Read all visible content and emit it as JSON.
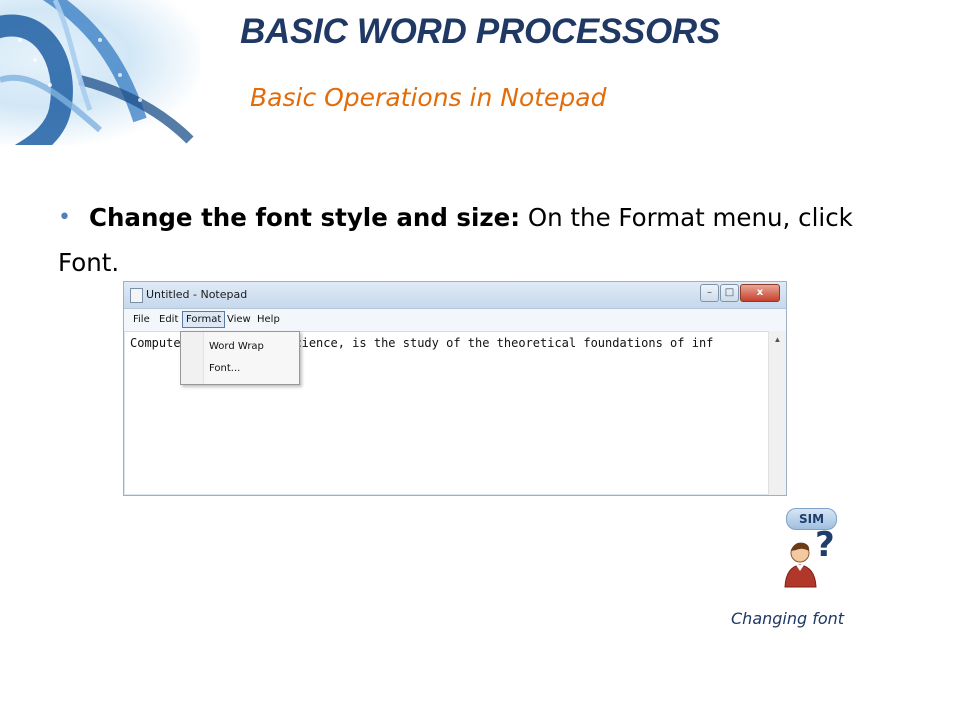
{
  "slide": {
    "title": "BASIC WORD PROCESSORS",
    "subtitle": "Basic Operations in Notepad",
    "bullet": {
      "bold": "Change the font style and size:",
      "text": " On the Format menu, click Font."
    },
    "caption": "Changing font",
    "sim_badge": "SIM",
    "sim_question": "?"
  },
  "notepad": {
    "window_title": "Untitled - Notepad",
    "controls": {
      "minimize": "–",
      "maximize": "□",
      "close": "x"
    },
    "menus": [
      "File",
      "Edit",
      "Format",
      "View",
      "Help"
    ],
    "active_menu": "Format",
    "text_left": "Compute",
    "text_right": "puting science, is the study of the theoretical foundations of inf",
    "dropdown_items": [
      "Word Wrap",
      "Font..."
    ],
    "highlighted_item": "Font...",
    "scroll_up": "▲"
  },
  "colors": {
    "title": "#1f3864",
    "subtitle": "#e36c09",
    "bullet": "#4f81bd",
    "caption": "#1f3864"
  }
}
